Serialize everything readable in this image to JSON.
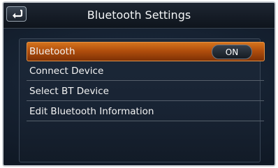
{
  "header": {
    "title": "Bluetooth Settings",
    "back_icon": "back-arrow-icon"
  },
  "menu": {
    "items": [
      {
        "label": "Bluetooth",
        "value": "ON",
        "highlighted": true
      },
      {
        "label": "Connect Device"
      },
      {
        "label": "Select BT Device"
      },
      {
        "label": "Edit Bluetooth Information"
      }
    ]
  },
  "colors": {
    "highlight": "#c25f14",
    "background": "#141f2d"
  }
}
